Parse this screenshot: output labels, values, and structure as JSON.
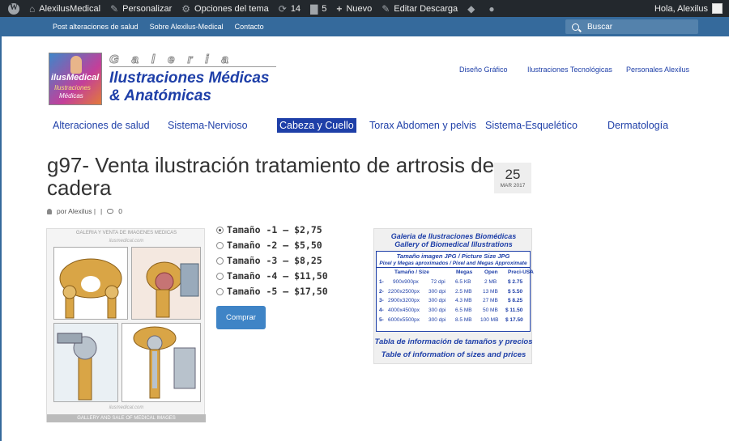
{
  "adminbar": {
    "site": "AlexilusMedical",
    "customize": "Personalizar",
    "theme_options": "Opciones del tema",
    "updates": "14",
    "comments": "5",
    "new": "Nuevo",
    "edit": "Editar Descarga",
    "greeting": "Hola, Alexilus"
  },
  "topnav": {
    "links": [
      "Post alteraciones de salud",
      "Sobre Alexilus-Medical",
      "Contacto"
    ],
    "search_placeholder": "Buscar"
  },
  "logo": {
    "box_line1": "ilusMedical",
    "box_line2": "Ilustraciones",
    "box_line3": "Médicas",
    "galeria": "Galeria",
    "line1": "Ilustraciones Médicas",
    "line2": "& Anatómicas"
  },
  "header_links": [
    "Diseño Gráfico",
    "Ilustraciones Tecnológicas",
    "Personales Alexilus"
  ],
  "categories": [
    "Alteraciones de salud",
    "Sistema-Nervioso",
    "Cabeza y Cuello",
    "Torax Abdomen y pelvis",
    "Sistema-Esquelético",
    "Dermatología"
  ],
  "active_category_index": 2,
  "post": {
    "title": "g97- Venta ilustración tratamiento de artrosis de cadera",
    "day": "25",
    "month_year": "MAR 2017",
    "author": "por Alexilus |",
    "separator": "|",
    "comments_count": "0"
  },
  "image": {
    "caption_top": "GALERIA Y VENTA DE IMAGENES MEDICAS",
    "caption_top2": "ilusmedical.com",
    "caption_bottom": "ilusmedical.com",
    "caption_bottom2": "GALLERY AND SALE OF MEDICAL IMAGES"
  },
  "options": [
    {
      "label": "Tamaño -1 – $2,75",
      "checked": true
    },
    {
      "label": "Tamaño -2 – $5,50",
      "checked": false
    },
    {
      "label": "Tamaño -3 – $8,25",
      "checked": false
    },
    {
      "label": "Tamaño -4 – $11,50",
      "checked": false
    },
    {
      "label": "Tamaño -5 – $17,50",
      "checked": false
    }
  ],
  "buy_button": "Comprar",
  "price_table": {
    "heading1": "Galeria de Ilustraciones Biomédicas",
    "heading2": "Gallery of Biomedical Illustrations",
    "box_title": "Tamaño imagen JPG / Picture Size JPG",
    "box_subtitle": "Pixel y Megas aproximados / Pixel and Megas Approximate",
    "columns": [
      "Tamaño / Size",
      "Megas",
      "Open",
      "Preci-USA"
    ],
    "rows": [
      [
        "1-",
        "900x900px",
        "72 dpi",
        "6.5 KB",
        "2 MB",
        "$ 2.75"
      ],
      [
        "2-",
        "2200x2500px",
        "300 dpi",
        "2.5 MB",
        "13 MB",
        "$ 5.50"
      ],
      [
        "3-",
        "2900x3200px",
        "300 dpi",
        "4.3 MB",
        "27 MB",
        "$ 8.25"
      ],
      [
        "4-",
        "4000x4500px",
        "300 dpi",
        "6.5 MB",
        "50 MB",
        "$ 11.50"
      ],
      [
        "5-",
        "6000x5500px",
        "300 dpi",
        "8.5 MB",
        "100 MB",
        "$ 17.50"
      ]
    ],
    "footer1": "Tabla de información de tamaños y precios",
    "footer2": "Table of information of sizes and prices"
  },
  "colors": {
    "adminbar": "#23282d",
    "topnav": "#356a9c",
    "brand_blue": "#1e3fa8",
    "button": "#3f84c6"
  }
}
